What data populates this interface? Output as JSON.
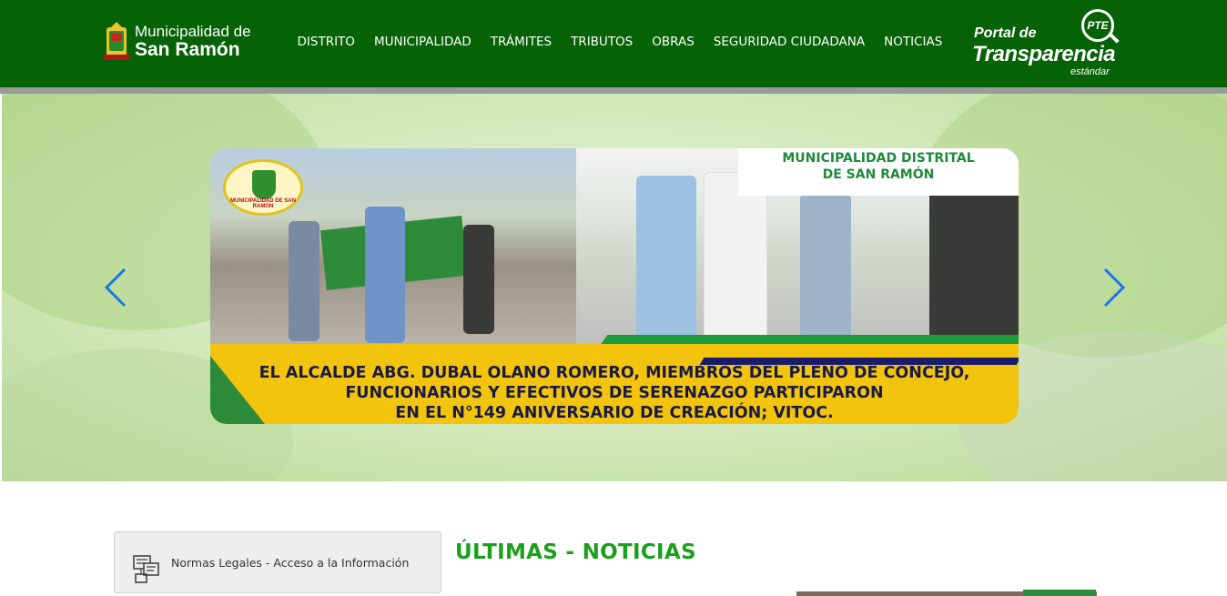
{
  "header": {
    "logo": {
      "line1": "Municipalidad de",
      "line2": "San Ramón"
    },
    "nav": [
      {
        "label": "DISTRITO"
      },
      {
        "label": "MUNICIPALIDAD"
      },
      {
        "label": "TRÁMITES"
      },
      {
        "label": "TRIBUTOS"
      },
      {
        "label": "OBRAS"
      },
      {
        "label": "SEGURIDAD CIUDADANA"
      },
      {
        "label": "NOTICIAS"
      }
    ],
    "transparency": {
      "badge": "PTE",
      "line1": "Portal de",
      "line2": "Transparencia",
      "line3": "estándar"
    }
  },
  "hero": {
    "slide": {
      "title_line1": "MUNICIPALIDAD DISTRITAL",
      "title_line2": "DE SAN RAMÓN",
      "caption_line1": "EL ALCALDE ABG. DUBAL OLANO ROMERO, MIEMBROS DEL PLENO DE CONCEJO,",
      "caption_line2": "FUNCIONARIOS Y EFECTIVOS DE SERENAZGO PARTICIPARON",
      "caption_line3": "EN EL N°149 ANIVERSARIO DE CREACIÓN; VITOC.",
      "seal_text": "MUNICIPALIDAD DE SAN RAMÓN"
    },
    "prev_icon": "chevron-left-icon",
    "next_icon": "chevron-right-icon"
  },
  "sidebar": {
    "normas_label": "Normas Legales - Acceso a la Información",
    "normas_icon": "legal-documents-icon"
  },
  "news": {
    "heading": "ÚLTIMAS - NOTICIAS"
  },
  "colors": {
    "header_green": "#056205",
    "accent_green": "#1aa01a",
    "arrow_blue": "#1e73e8"
  }
}
